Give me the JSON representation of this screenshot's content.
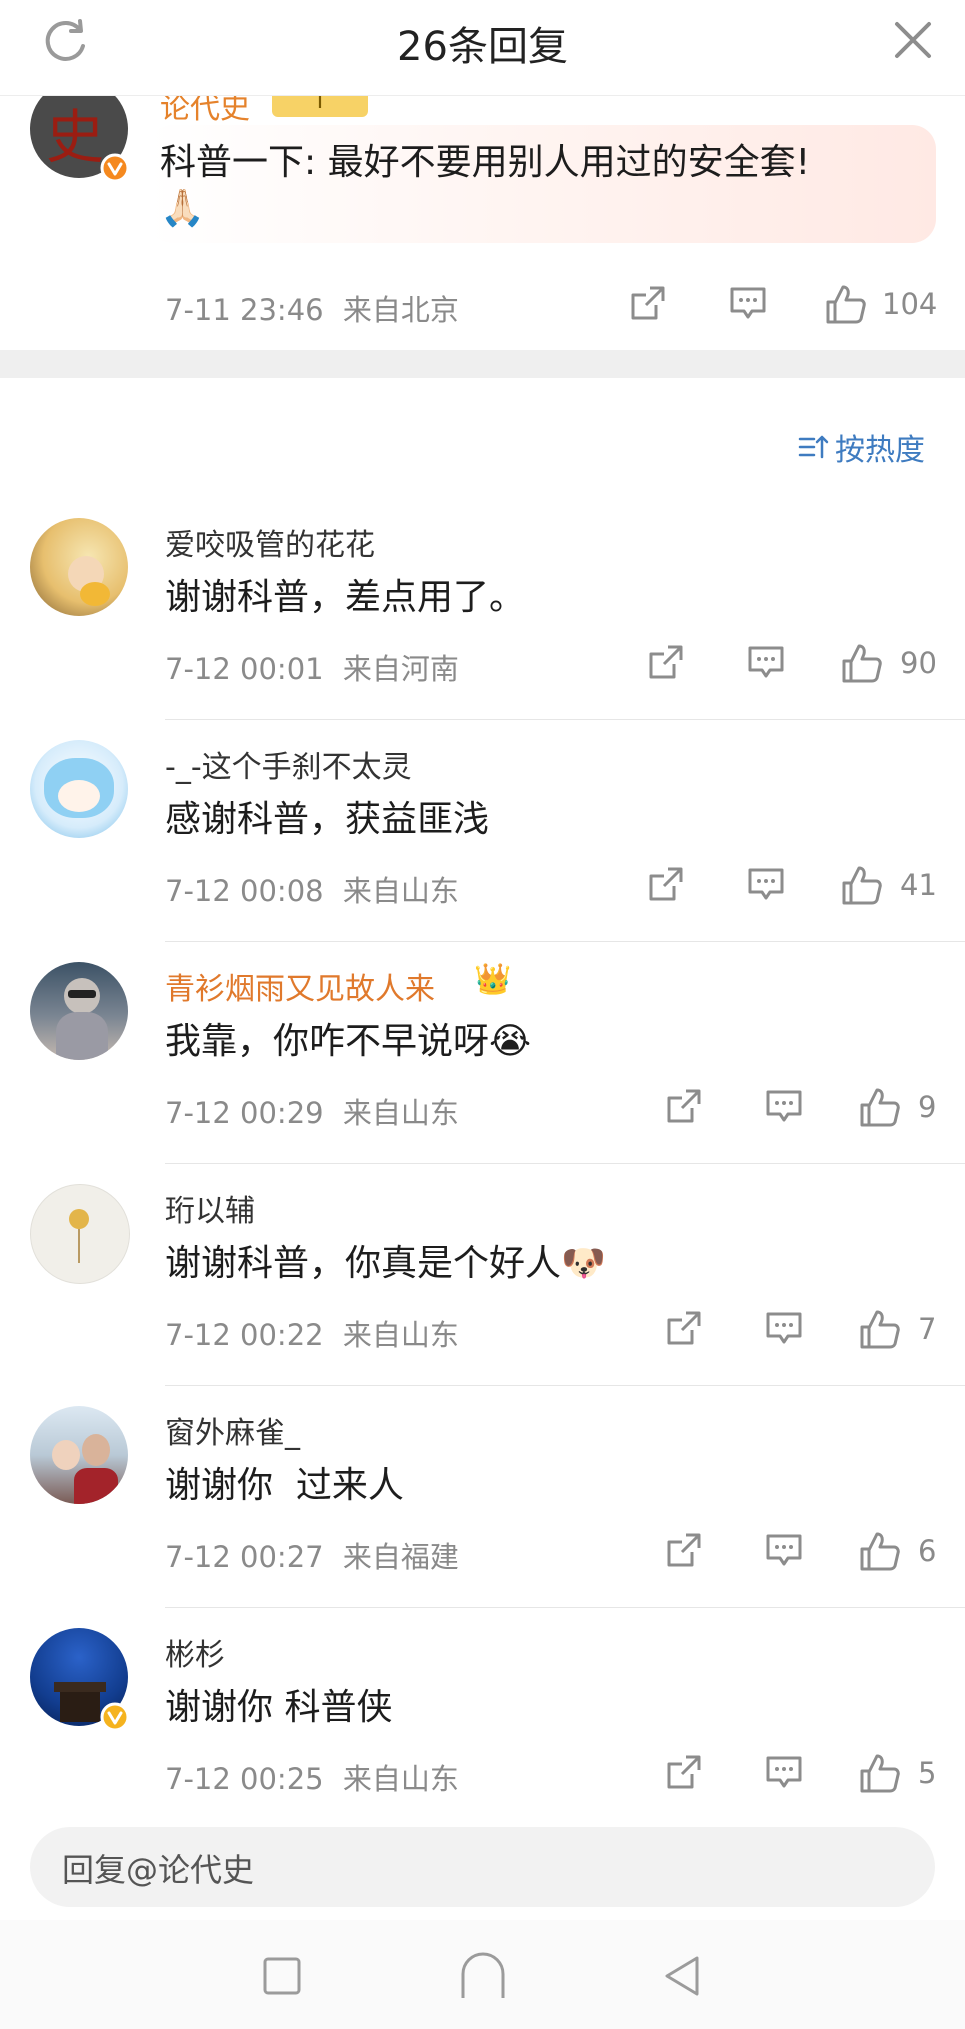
{
  "header": {
    "title": "26条回复"
  },
  "main_comment": {
    "username": "论代史",
    "badge": "I",
    "text": "科普一下: 最好不要用别人用过的安全套!",
    "emoji": "🙏🏻",
    "time": "7-11 23:46",
    "location": "来自北京",
    "likes": "104"
  },
  "sort": {
    "label": "按热度"
  },
  "comments": [
    {
      "username": "爱咬吸管的花花",
      "text": "谢谢科普，差点用了。",
      "time": "7-12 00:01",
      "location": "来自河南",
      "likes": "90"
    },
    {
      "username": "-_-这个手刹不太灵",
      "text": "感谢科普，获益匪浅",
      "time": "7-12 00:08",
      "location": "来自山东",
      "likes": "41"
    },
    {
      "username": "青衫烟雨又见故人来",
      "crown": "👑",
      "text": "我靠，你咋不早说呀😭",
      "time": "7-12 00:29",
      "location": "来自山东",
      "likes": "9"
    },
    {
      "username": "珩以辅",
      "text": "谢谢科普，你真是个好人🐶",
      "time": "7-12 00:22",
      "location": "来自山东",
      "likes": "7"
    },
    {
      "username": "窗外麻雀_",
      "text": "谢谢你  过来人",
      "time": "7-12 00:27",
      "location": "来自福建",
      "likes": "6"
    },
    {
      "username": "彬杉",
      "text": "谢谢你 科普侠",
      "time": "7-12 00:25",
      "location": "来自山东",
      "likes": "5"
    }
  ],
  "reply": {
    "placeholder": "回复@论代史"
  },
  "colors": {
    "vip_name": "#e0792c",
    "sort_link": "#3e7bc0",
    "meta": "#8a8a8a"
  },
  "icons": [
    "refresh-icon",
    "close-icon",
    "share-icon",
    "comment-icon",
    "like-icon",
    "sort-icon",
    "verified-icon",
    "square-nav-icon",
    "home-nav-icon",
    "back-nav-icon"
  ]
}
